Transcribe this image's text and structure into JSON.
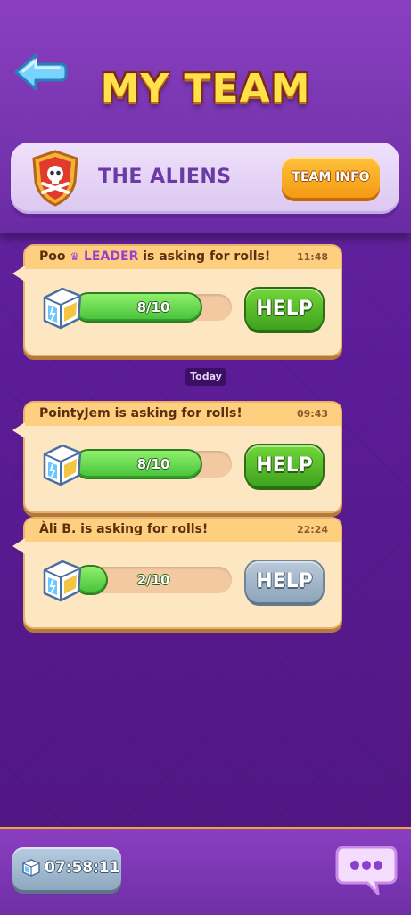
{
  "header": {
    "title": "MY TEAM",
    "team_name": "THE ALIENS",
    "team_info_label": "TEAM INFO"
  },
  "requests": [
    {
      "name": "Poo",
      "role": "LEADER",
      "message": "is asking for rolls!",
      "time": "11:48",
      "progress_label": "8/10",
      "progress_fraction": 0.8,
      "help_label": "HELP",
      "help_enabled": true
    },
    {
      "name": "PointyJem",
      "message": "is asking for rolls!",
      "time": "09:43",
      "progress_label": "8/10",
      "progress_fraction": 0.8,
      "help_label": "HELP",
      "help_enabled": true
    },
    {
      "name": "Àli B.",
      "message": "is asking for rolls!",
      "time": "22:24",
      "progress_label": "2/10",
      "progress_fraction": 0.2,
      "help_label": "HELP",
      "help_enabled": false
    }
  ],
  "date_separator": "Today",
  "footer": {
    "timer": "07:58:11"
  },
  "colors": {
    "background": "#5c1c97",
    "title_yellow": "#ffe24a",
    "help_green": "#3fa21e",
    "help_disabled": "#8ea5bb",
    "team_info_orange": "#f39a13"
  }
}
